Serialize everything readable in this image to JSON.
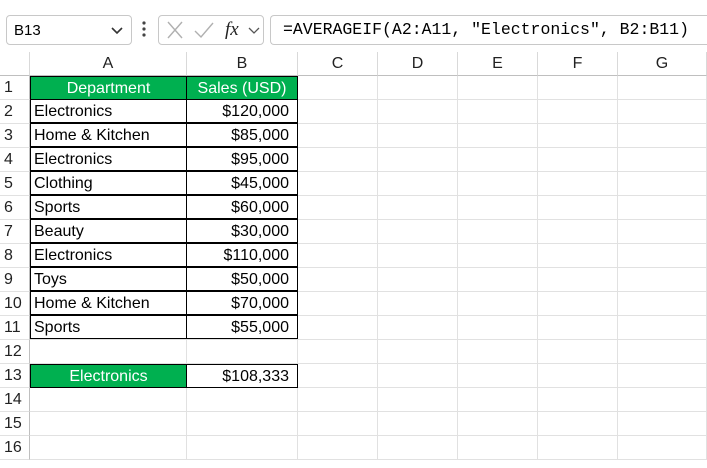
{
  "formula_bar": {
    "name_box": "B13",
    "fx_label": "fx",
    "formula": "=AVERAGEIF(A2:A11, \"Electronics\", B2:B11)"
  },
  "columns": [
    "A",
    "B",
    "C",
    "D",
    "E",
    "F",
    "G"
  ],
  "rows": [
    "1",
    "2",
    "3",
    "4",
    "5",
    "6",
    "7",
    "8",
    "9",
    "10",
    "11",
    "12",
    "13",
    "14",
    "15",
    "16"
  ],
  "table": {
    "headers": [
      "Department",
      "Sales (USD)"
    ],
    "rows": [
      [
        "Electronics",
        "$120,000"
      ],
      [
        "Home & Kitchen",
        "$85,000"
      ],
      [
        "Electronics",
        "$95,000"
      ],
      [
        "Clothing",
        "$45,000"
      ],
      [
        "Sports",
        "$60,000"
      ],
      [
        "Beauty",
        "$30,000"
      ],
      [
        "Electronics",
        "$110,000"
      ],
      [
        "Toys",
        "$50,000"
      ],
      [
        "Home & Kitchen",
        "$70,000"
      ],
      [
        "Sports",
        "$55,000"
      ]
    ]
  },
  "result": {
    "label": "Electronics",
    "value": "$108,333"
  },
  "colors": {
    "header_green": "#00b050",
    "grid_line": "#e1e1e1"
  }
}
